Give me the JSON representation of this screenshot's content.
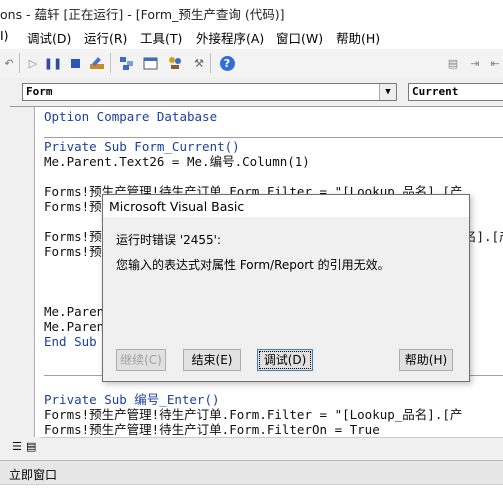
{
  "window": {
    "title": "ons - 蕴轩 [正在运行] - [Form_预生产查询 (代码)]"
  },
  "menubar": {
    "items": [
      "I)",
      "调试(D)",
      "运行(R)",
      "工具(T)",
      "外接程序(A)",
      "窗口(W)",
      "帮助(H)"
    ]
  },
  "combos": {
    "object": "Form",
    "procedure": "Current"
  },
  "code": {
    "lines": [
      "Option Compare Database",
      "",
      "Private Sub Form_Current()",
      "Me.Parent.Text26 = Me.编号.Column(1)",
      "",
      "Forms!预生产管理!待生产订单.Form.Filter = \"[Lookup_品名].[产",
      "Forms!预",
      "",
      "Forms!预",
      "Forms!预",
      "",
      "",
      "",
      "Me.Paren",
      "Me.Paren",
      "End Sub",
      "",
      "",
      "Private Sub 编号_Enter()",
      "Forms!预生产管理!待生产订单.Form.Filter = \"[Lookup_品名].[产",
      "Forms!预生产管理!待生产订单.Form.FilterOn = True"
    ],
    "line9_tail": "名].[产"
  },
  "dialog": {
    "title": "Microsoft Visual Basic",
    "error_line": "运行时错误 '2455':",
    "message": "您输入的表达式对属性 Form/Report 的引用无效。",
    "buttons": {
      "continue": "继续(C)",
      "end": "结束(E)",
      "debug": "调试(D)",
      "help": "帮助(H)"
    }
  },
  "immediate": {
    "title": "立即窗口"
  }
}
